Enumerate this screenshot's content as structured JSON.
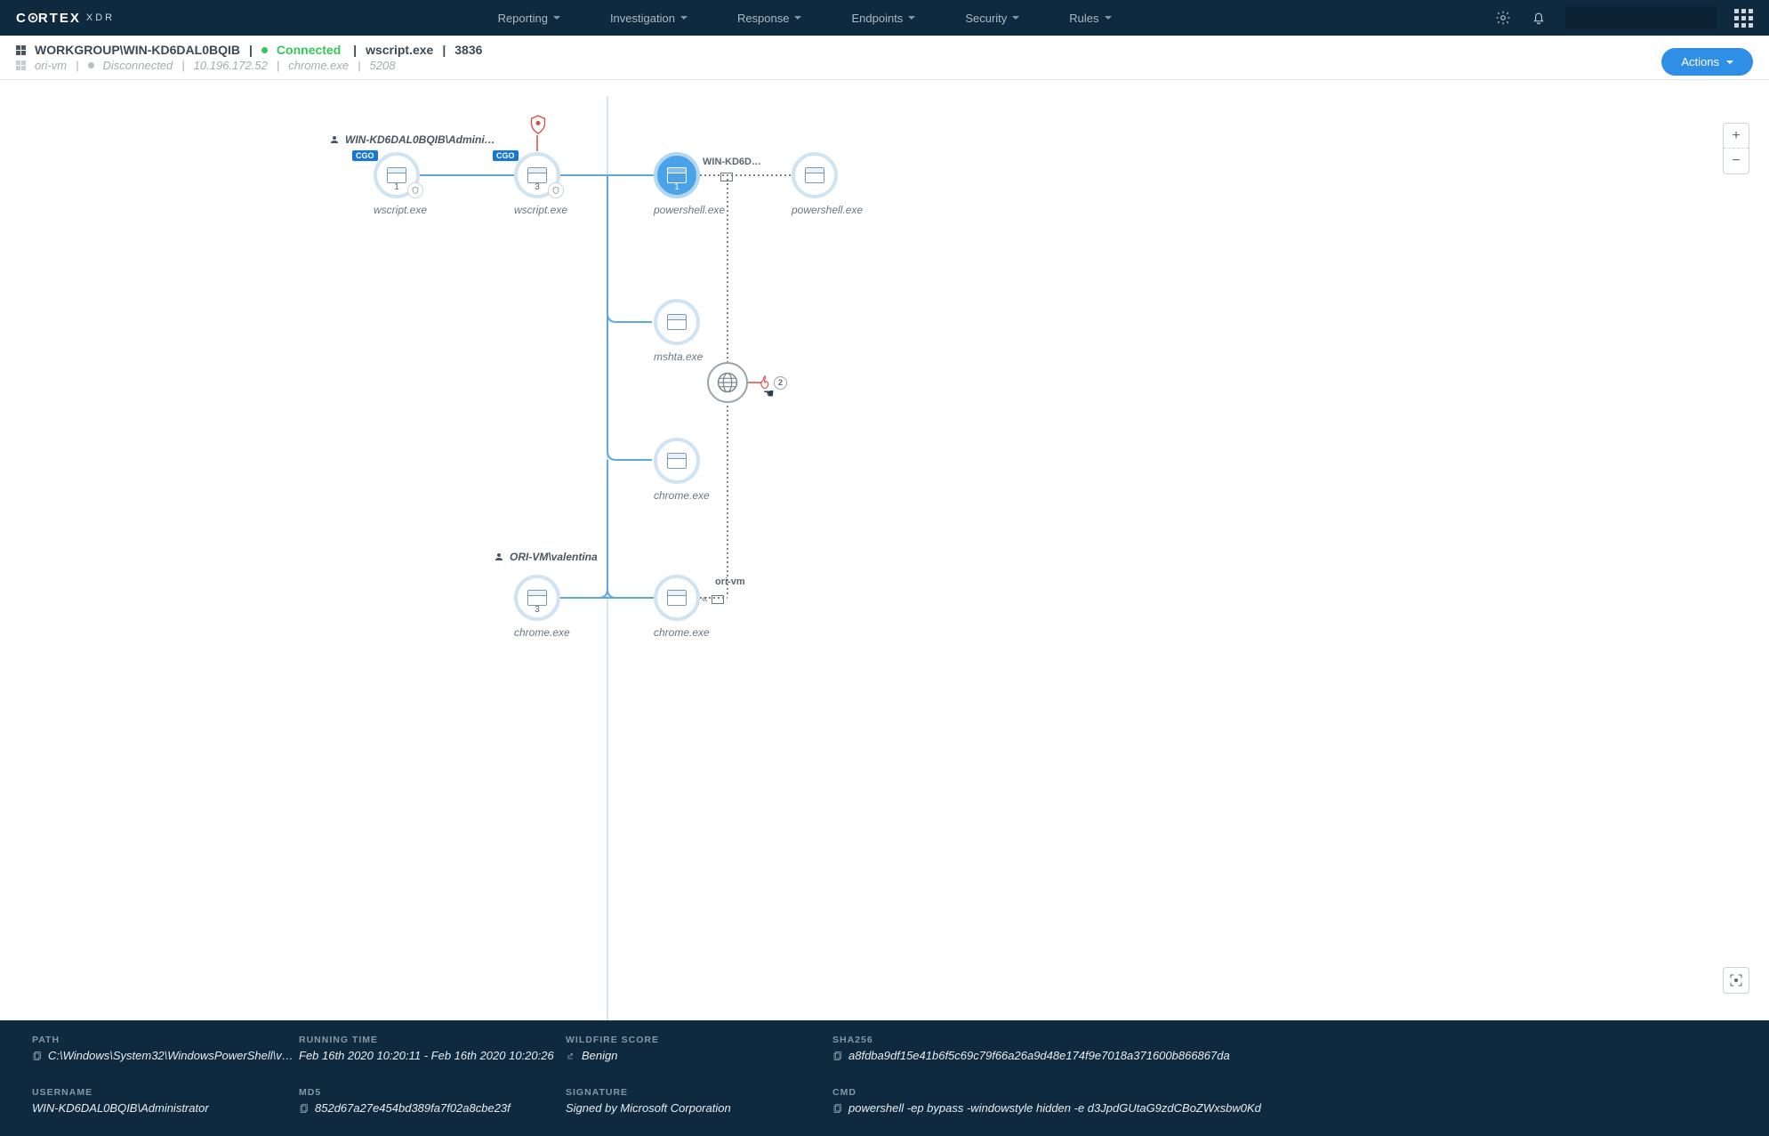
{
  "brand": {
    "name_html": "CORTEX",
    "suffix": "XDR"
  },
  "nav": {
    "items": [
      "Reporting",
      "Investigation",
      "Response",
      "Endpoints",
      "Security",
      "Rules"
    ]
  },
  "context": {
    "primary": {
      "host": "WORKGROUP\\WIN-KD6DAL0BQIB",
      "status_label": "Connected",
      "process": "wscript.exe",
      "pid": "3836"
    },
    "secondary": {
      "host": "ori-vm",
      "status_label": "Disconnected",
      "ip": "10.196.172.52",
      "process": "chrome.exe",
      "pid": "5208"
    }
  },
  "actions_label": "Actions",
  "users": {
    "top": "WIN-KD6DAL0BQIB\\Admini…",
    "bottom": "ORI-VM\\valentina"
  },
  "host_labels": {
    "top": "WIN-KD6D…",
    "bottom": "ori-vm"
  },
  "nodes": {
    "wscript1": {
      "label": "wscript.exe",
      "count": "1",
      "cgo": "CGO"
    },
    "wscript2": {
      "label": "wscript.exe",
      "count": "3",
      "cgo": "CGO"
    },
    "ps1": {
      "label": "powershell.exe",
      "count": "1"
    },
    "ps2": {
      "label": "powershell.exe"
    },
    "mshta": {
      "label": "mshta.exe"
    },
    "chrome_mid": {
      "label": "chrome.exe"
    },
    "chrome_btm1": {
      "label": "chrome.exe",
      "count": "3"
    },
    "chrome_btm2": {
      "label": "chrome.exe"
    }
  },
  "alert_count": "2",
  "details": {
    "path": {
      "k": "PATH",
      "v": "C:\\Windows\\System32\\WindowsPowerShell\\v…"
    },
    "running_time": {
      "k": "RUNNING TIME",
      "v": "Feb 16th 2020 10:20:11 - Feb 16th 2020 10:20:26"
    },
    "wildfire": {
      "k": "WILDFIRE SCORE",
      "v": "Benign"
    },
    "sha256": {
      "k": "SHA256",
      "v": "a8fdba9df15e41b6f5c69c79f66a26a9d48e174f9e7018a371600b866867da"
    },
    "username": {
      "k": "USERNAME",
      "v": "WIN-KD6DAL0BQIB\\Administrator"
    },
    "md5": {
      "k": "MD5",
      "v": "852d67a27e454bd389fa7f02a8cbe23f"
    },
    "signature": {
      "k": "SIGNATURE",
      "v": "Signed by Microsoft Corporation"
    },
    "cmd": {
      "k": "CMD",
      "v": "powershell -ep bypass -windowstyle hidden -e d3JpdGUtaG9zdCBoZWxsbw0Kd"
    }
  }
}
